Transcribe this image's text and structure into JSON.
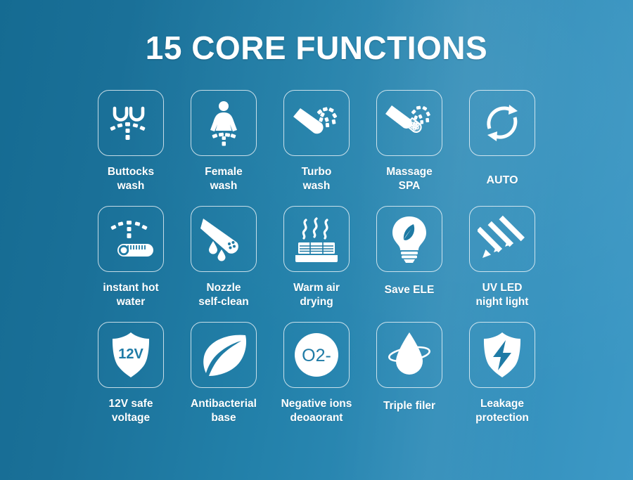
{
  "page": {
    "title": "15 CORE FUNCTIONS",
    "background_gradient_from": "#156b92",
    "background_gradient_to": "#3d99c6",
    "text_color": "#ffffff",
    "box_border_color": "#ffffff"
  },
  "features": [
    {
      "id": "buttocks-wash",
      "label": "Buttocks\nwash",
      "icon": "buttocks-wash-icon"
    },
    {
      "id": "female-wash",
      "label": "Female\nwash",
      "icon": "female-wash-icon"
    },
    {
      "id": "turbo-wash",
      "label": "Turbo\nwash",
      "icon": "turbo-wash-icon"
    },
    {
      "id": "massage-spa",
      "label": "Massage\nSPA",
      "icon": "massage-spa-icon"
    },
    {
      "id": "auto",
      "label": "AUTO",
      "icon": "auto-cycle-icon"
    },
    {
      "id": "instant-hot-water",
      "label": "instant hot\nwater",
      "icon": "thermometer-spray-icon"
    },
    {
      "id": "nozzle-self-clean",
      "label": "Nozzle\nself-clean",
      "icon": "nozzle-droplet-icon"
    },
    {
      "id": "warm-air-drying",
      "label": "Warm air\ndrying",
      "icon": "heater-steam-icon"
    },
    {
      "id": "save-ele",
      "label": "Save ELE",
      "icon": "bulb-leaf-icon"
    },
    {
      "id": "uv-led-night-light",
      "label": "UV LED\nnight light",
      "icon": "uv-arrows-icon"
    },
    {
      "id": "12v-safe-voltage",
      "label": "12V safe\nvoltage",
      "icon": "shield-12v-icon",
      "badge_text": "12V"
    },
    {
      "id": "antibacterial-base",
      "label": "Antibacterial\nbase",
      "icon": "leaf-icon"
    },
    {
      "id": "negative-ions",
      "label": "Negative ions\ndeoaorant",
      "icon": "o2-circle-icon",
      "badge_text": "O2-"
    },
    {
      "id": "triple-filer",
      "label": "Triple filer",
      "icon": "droplet-ring-icon"
    },
    {
      "id": "leakage-protection",
      "label": "Leakage\nprotection",
      "icon": "shield-bolt-icon"
    }
  ]
}
